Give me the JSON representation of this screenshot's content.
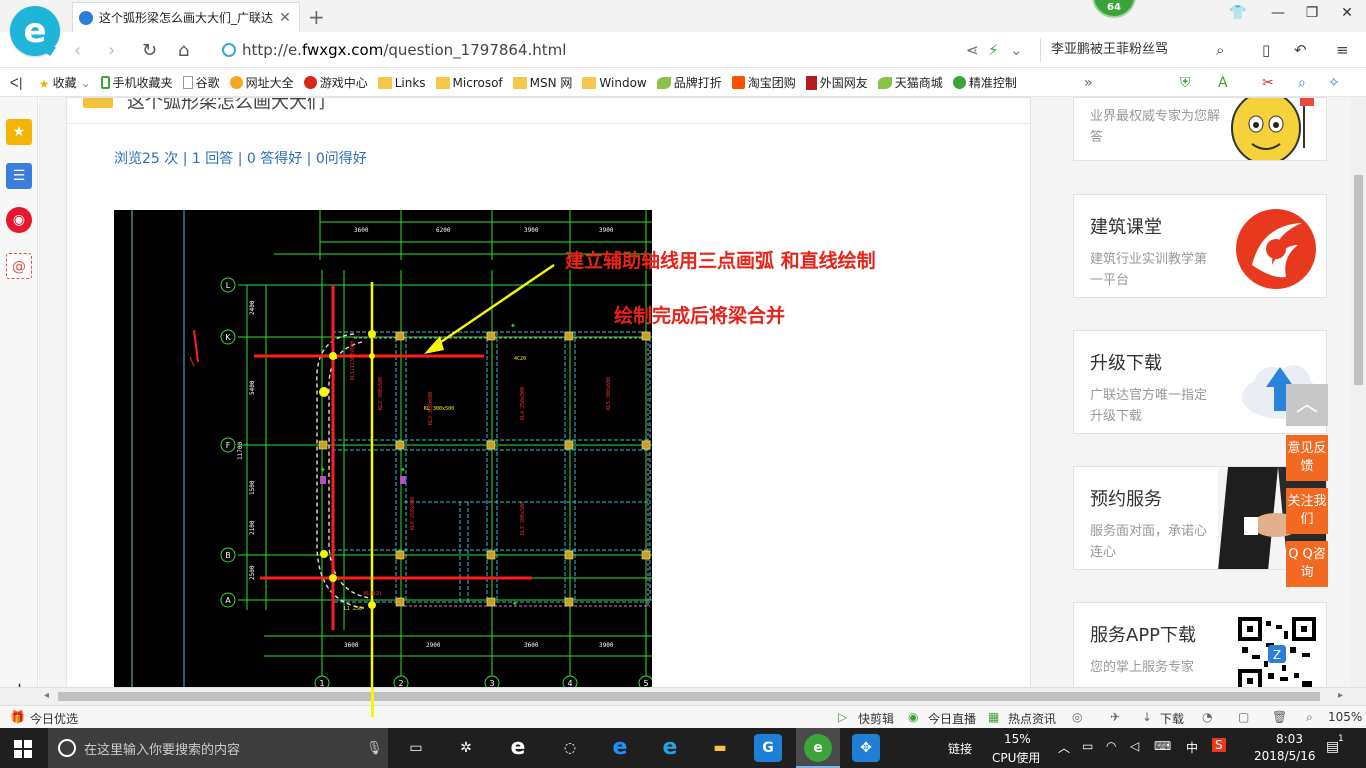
{
  "tab": {
    "title": "这个弧形梁怎么画大大们_广联达"
  },
  "badge": {
    "count": "64"
  },
  "address": {
    "url_prefix": "http://e.",
    "url_domain": "fwxgx.com",
    "url_path": "/question_1797864.html"
  },
  "search": {
    "text": "李亚鹏被王菲粉丝骂"
  },
  "bookmarks": [
    {
      "label": "收藏",
      "icon": "star-icon"
    },
    {
      "label": "手机收藏夹",
      "icon": "phone-icon"
    },
    {
      "label": "谷歌",
      "icon": "page-icon"
    },
    {
      "label": "网址大全",
      "icon": "globe-icon"
    },
    {
      "label": "游戏中心",
      "icon": "game-icon"
    },
    {
      "label": "Links",
      "icon": "folder-icon"
    },
    {
      "label": "Microsof",
      "icon": "folder-icon"
    },
    {
      "label": "MSN 网",
      "icon": "folder-icon"
    },
    {
      "label": "Window",
      "icon": "folder-icon"
    },
    {
      "label": "品牌打折",
      "icon": "leaf-icon"
    },
    {
      "label": "淘宝团购",
      "icon": "taobao-icon"
    },
    {
      "label": "外国网友",
      "icon": "flag-icon"
    },
    {
      "label": "天猫商城",
      "icon": "leaf-icon"
    },
    {
      "label": "精准控制",
      "icon": "chat-icon"
    }
  ],
  "question": {
    "title": "这个弧形梁怎么画大大们",
    "stats": "浏览25 次 | 1 回答 | 0 答得好 | 0问得好"
  },
  "annotations": {
    "line1": "建立辅助轴线用三点画弧 和直线绘制",
    "line2": "绘制完成后将梁合并"
  },
  "cad": {
    "row_labels": [
      "L",
      "K",
      "F",
      "B",
      "A"
    ],
    "col_labels": [
      "1",
      "2",
      "3",
      "4",
      "5"
    ]
  },
  "sidebar_cards": [
    {
      "title": "",
      "subtitle": "业界最权威专家为您解答"
    },
    {
      "title": "建筑课堂",
      "subtitle": "建筑行业实训教学第一平台"
    },
    {
      "title": "升级下载",
      "subtitle": "广联达官方唯一指定升级下载"
    },
    {
      "title": "预约服务",
      "subtitle": "服务面对面，承诺心连心"
    },
    {
      "title": "服务APP下载",
      "subtitle": "您的掌上服务专家"
    }
  ],
  "float_buttons": [
    {
      "label": "意见反馈"
    },
    {
      "label": "关注我们"
    },
    {
      "label": "Q Q咨询"
    }
  ],
  "statusbar": {
    "left": "今日优选",
    "items": [
      "快剪辑",
      "今日直播",
      "热点资讯",
      "下载"
    ],
    "zoom": "105%"
  },
  "taskbar": {
    "search_placeholder": "在这里输入你要搜索的内容",
    "links_label": "链接",
    "cpu_percent": "15%",
    "cpu_label": "CPU使用",
    "ime": "中",
    "time": "8:03",
    "date": "2018/5/16",
    "notifications": "1"
  },
  "colors": {
    "accent_cyan": "#1fb5d8",
    "annotation_red": "#e8241a",
    "float_orange": "#f26a22",
    "link_blue": "#2a6fb7"
  }
}
